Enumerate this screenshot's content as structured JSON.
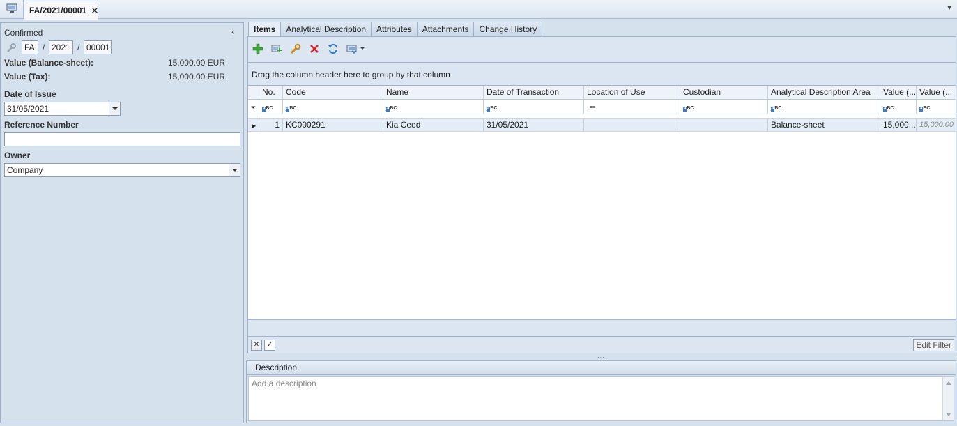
{
  "topbar": {
    "doc_tab": "FA/2021/00001",
    "close": "✕"
  },
  "header": {
    "status": "Confirmed",
    "number": {
      "prefix": "FA",
      "year": "2021",
      "seq": "00001",
      "sep": "/"
    },
    "value_balance_label": "Value (Balance-sheet):",
    "value_balance": "15,000.00 EUR",
    "value_tax_label": "Value (Tax):",
    "value_tax": "15,000.00 EUR",
    "date_issue_label": "Date of Issue",
    "date_issue": "31/05/2021",
    "reference_label": "Reference Number",
    "reference_value": "",
    "owner_label": "Owner",
    "owner_value": "Company"
  },
  "tabs": [
    "Items",
    "Analytical Description",
    "Attributes",
    "Attachments",
    "Change History"
  ],
  "toolbar": {
    "icons": [
      "add-icon",
      "add-multiple-icon",
      "edit-icon",
      "delete-icon",
      "refresh-icon",
      "export-icon"
    ]
  },
  "grid": {
    "group_hint": "Drag the column header here to group by that column",
    "columns": [
      "No.",
      "Code",
      "Name",
      "Date of Transaction",
      "Location of Use",
      "Custodian",
      "Analytical Description Area",
      "Value (...",
      "Value (..."
    ],
    "rows": [
      {
        "no": "1",
        "code": "KC000291",
        "name": "Kia Ceed",
        "date": "31/05/2021",
        "location": "",
        "custodian": "",
        "area": "Balance-sheet",
        "value1": "15,000...",
        "value2": "15,000.00"
      }
    ],
    "edit_filter": "Edit Filter"
  },
  "description": {
    "title": "Description",
    "placeholder": "Add a description"
  }
}
